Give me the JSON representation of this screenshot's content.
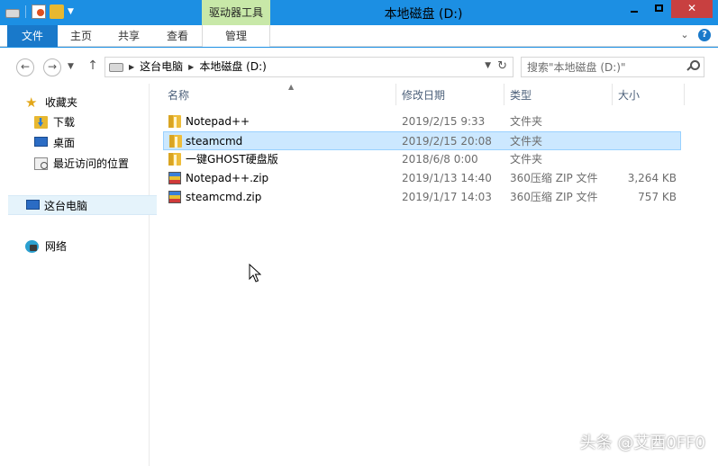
{
  "window": {
    "title": "本地磁盘 (D:)",
    "context_tab_header": "驱动器工具"
  },
  "ribbon": {
    "tabs": [
      "文件",
      "主页",
      "共享",
      "查看",
      "管理"
    ]
  },
  "address": {
    "crumbs": [
      "这台电脑",
      "本地磁盘 (D:)"
    ]
  },
  "search": {
    "placeholder": "搜索\"本地磁盘 (D:)\""
  },
  "nav": {
    "favorites": "收藏夹",
    "downloads": "下载",
    "desktop": "桌面",
    "recent": "最近访问的位置",
    "this_pc": "这台电脑",
    "network": "网络"
  },
  "columns": {
    "name": "名称",
    "date": "修改日期",
    "type": "类型",
    "size": "大小"
  },
  "files": [
    {
      "name": "Notepad++",
      "date": "2019/2/15 9:33",
      "type": "文件夹",
      "size": "",
      "icon": "folder-icon",
      "selected": false
    },
    {
      "name": "steamcmd",
      "date": "2019/2/15 20:08",
      "type": "文件夹",
      "size": "",
      "icon": "folder-icon",
      "selected": true
    },
    {
      "name": "一键GHOST硬盘版",
      "date": "2018/6/8 0:00",
      "type": "文件夹",
      "size": "",
      "icon": "folder-icon",
      "selected": false
    },
    {
      "name": "Notepad++.zip",
      "date": "2019/1/13 14:40",
      "type": "360压缩 ZIP 文件",
      "size": "3,264 KB",
      "icon": "zip-icon",
      "selected": false
    },
    {
      "name": "steamcmd.zip",
      "date": "2019/1/17 14:03",
      "type": "360压缩 ZIP 文件",
      "size": "757 KB",
      "icon": "zip-icon",
      "selected": false
    }
  ],
  "watermark": "头条 @艾西0FF0",
  "colors": {
    "titlebar": "#1c8fe3",
    "file_tab": "#1979ca",
    "context_tab": "#c8e8a8",
    "close_button": "#c84040",
    "selection": "#cce8ff"
  }
}
